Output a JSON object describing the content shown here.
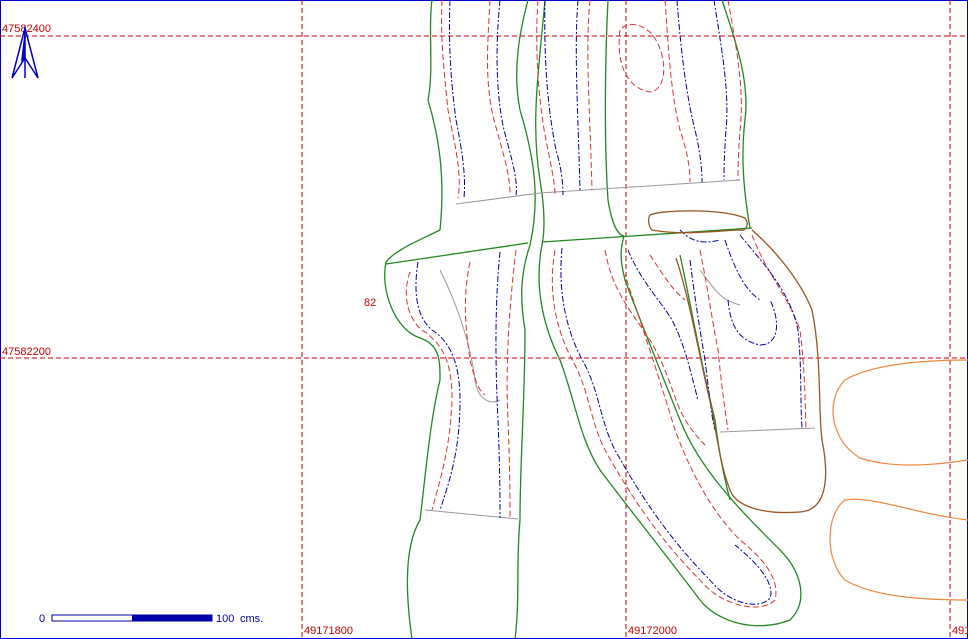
{
  "grid_labels": {
    "north_top": "47582400",
    "north_mid": "47582200",
    "east_left": "49171800",
    "east_mid": "49172000",
    "east_right": "491"
  },
  "contour_label": "82",
  "scale_bar": {
    "start": "0",
    "end_label": "100",
    "unit": "cms."
  },
  "colors": {
    "grid": "#cc0000",
    "parcel_boundary": "#228822",
    "contour_red": "#dd3333",
    "contour_blue": "#0000aa",
    "feature_brown": "#995522",
    "feature_orange": "#ee8844",
    "north_arrow": "#0000cc"
  }
}
